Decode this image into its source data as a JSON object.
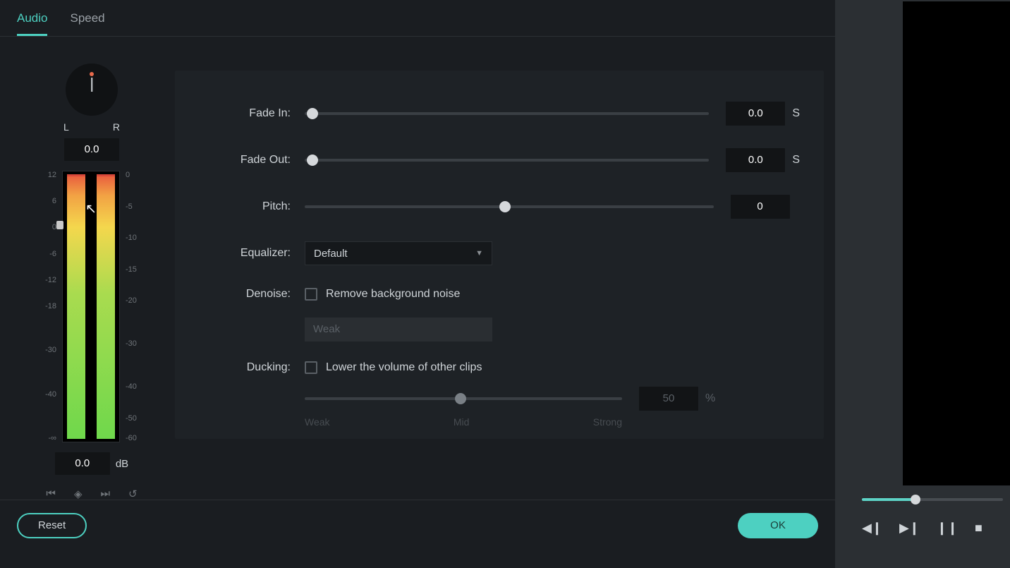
{
  "tabs": {
    "audio": "Audio",
    "speed": "Speed"
  },
  "pan": {
    "l_label": "L",
    "r_label": "R",
    "value": "0.0"
  },
  "meter": {
    "ticks_left": [
      "12",
      "6",
      "0",
      "-6",
      "-12",
      "-18",
      " ",
      "-30",
      " ",
      "-40",
      " ",
      "-∞"
    ],
    "ticks_right": [
      "0",
      " ",
      "-5",
      " ",
      "-10",
      " ",
      "-15",
      " ",
      "-20",
      " ",
      " ",
      "-30",
      " ",
      " ",
      "-40",
      " ",
      "-50",
      "-60"
    ],
    "db_value": "0.0",
    "db_unit": "dB"
  },
  "settings": {
    "fade_in": {
      "label": "Fade In:",
      "value": "0.0",
      "unit": "S"
    },
    "fade_out": {
      "label": "Fade Out:",
      "value": "0.0",
      "unit": "S"
    },
    "pitch": {
      "label": "Pitch:",
      "value": "0"
    },
    "equalizer": {
      "label": "Equalizer:",
      "value": "Default"
    },
    "denoise": {
      "label": "Denoise:",
      "checkbox_label": "Remove background noise",
      "strength": "Weak"
    },
    "ducking": {
      "label": "Ducking:",
      "checkbox_label": "Lower the volume of other clips",
      "value": "50",
      "unit": "%",
      "ticks": {
        "weak": "Weak",
        "mid": "Mid",
        "strong": "Strong"
      }
    }
  },
  "buttons": {
    "reset": "Reset",
    "ok": "OK"
  },
  "keyframe_icons": {
    "prev": "⏮",
    "add": "◈",
    "next": "⏭",
    "undo": "↺"
  }
}
